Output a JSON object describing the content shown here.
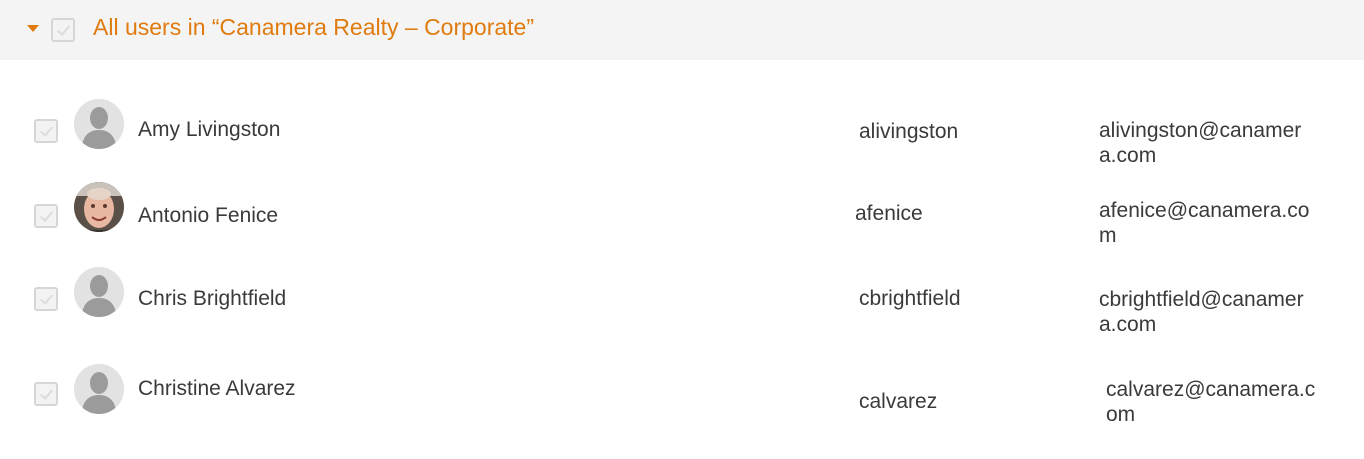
{
  "group": {
    "title": "All users in “Canamera Realty – Corporate”",
    "accent_color": "#e07b10",
    "expand_icon": "caret-down-icon"
  },
  "users": [
    {
      "name": "Amy Livingston",
      "username": "alivingston",
      "email": "alivingston@canamera.com",
      "avatar": "default-person-icon"
    },
    {
      "name": "Antonio Fenice",
      "username": "afenice",
      "email": "afenice@canamera.com",
      "avatar": "photo"
    },
    {
      "name": "Chris Brightfield",
      "username": "cbrightfield",
      "email": "cbrightfield@canamera.com",
      "avatar": "default-person-icon"
    },
    {
      "name": "Christine Alvarez",
      "username": "calvarez",
      "email": "calvarez@canamera.com",
      "avatar": "default-person-icon"
    }
  ]
}
